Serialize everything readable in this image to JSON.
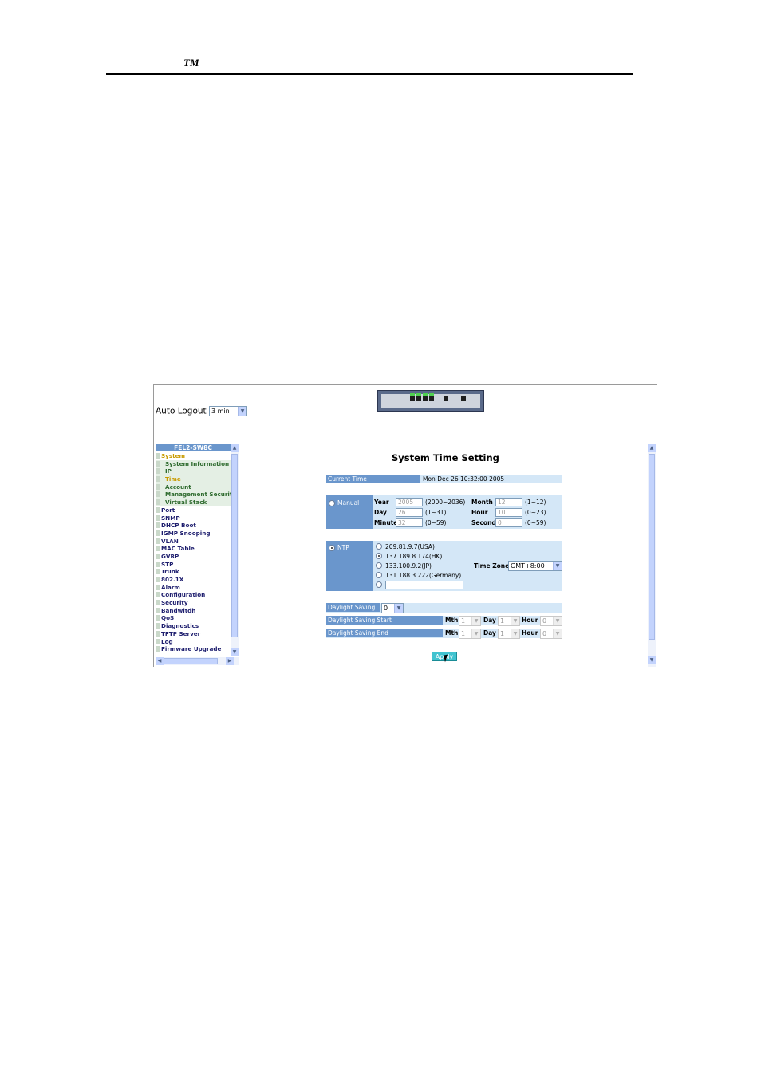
{
  "header": {
    "tm": "TM"
  },
  "auto_logout": {
    "label": "Auto Logout",
    "value": "3 min"
  },
  "menu": {
    "title": "FEL2-SW8C",
    "items": [
      {
        "label": "System"
      },
      {
        "label": "System Information"
      },
      {
        "label": "IP"
      },
      {
        "label": "Time"
      },
      {
        "label": "Account"
      },
      {
        "label": "Management Securit"
      },
      {
        "label": "Virtual Stack"
      },
      {
        "label": "Port"
      },
      {
        "label": "SNMP"
      },
      {
        "label": "DHCP Boot"
      },
      {
        "label": "IGMP Snooping"
      },
      {
        "label": "VLAN"
      },
      {
        "label": "MAC Table"
      },
      {
        "label": "GVRP"
      },
      {
        "label": "STP"
      },
      {
        "label": "Trunk"
      },
      {
        "label": "802.1X"
      },
      {
        "label": "Alarm"
      },
      {
        "label": "Configuration"
      },
      {
        "label": "Security"
      },
      {
        "label": "Bandwitdh"
      },
      {
        "label": "QoS"
      },
      {
        "label": "Diagnostics"
      },
      {
        "label": "TFTP Server"
      },
      {
        "label": "Log"
      },
      {
        "label": "Firmware Upgrade"
      }
    ]
  },
  "main": {
    "title": "System Time Setting",
    "current_time": {
      "label": "Current Time",
      "value": "Mon Dec 26 10:32:00 2005"
    },
    "manual": {
      "label": "Manual",
      "year": {
        "label": "Year",
        "value": "2005",
        "range": "(2000~2036)"
      },
      "month": {
        "label": "Month",
        "value": "12",
        "range": "(1~12)"
      },
      "day": {
        "label": "Day",
        "value": "26",
        "range": "(1~31)"
      },
      "hour": {
        "label": "Hour",
        "value": "10",
        "range": "(0~23)"
      },
      "minute": {
        "label": "Minute",
        "value": "32",
        "range": "(0~59)"
      },
      "second": {
        "label": "Second",
        "value": "0",
        "range": "(0~59)"
      }
    },
    "ntp": {
      "label": "NTP",
      "servers": [
        "209.81.9.7(USA)",
        "137.189.8.174(HK)",
        "133.100.9.2(JP)",
        "131.188.3.222(Germany)"
      ],
      "timezone": {
        "label": "Time Zone",
        "value": "GMT+8:00"
      }
    },
    "daylight": {
      "label": "Daylight Saving",
      "value": "0",
      "start_label": "Daylight Saving Start",
      "end_label": "Daylight Saving End",
      "mth_label": "Mth",
      "day_label": "Day",
      "hour_label": "Hour",
      "start": {
        "mth": "1",
        "day": "1",
        "hour": "0"
      },
      "end": {
        "mth": "1",
        "day": "1",
        "hour": "0"
      }
    },
    "apply_label": "Apply"
  }
}
